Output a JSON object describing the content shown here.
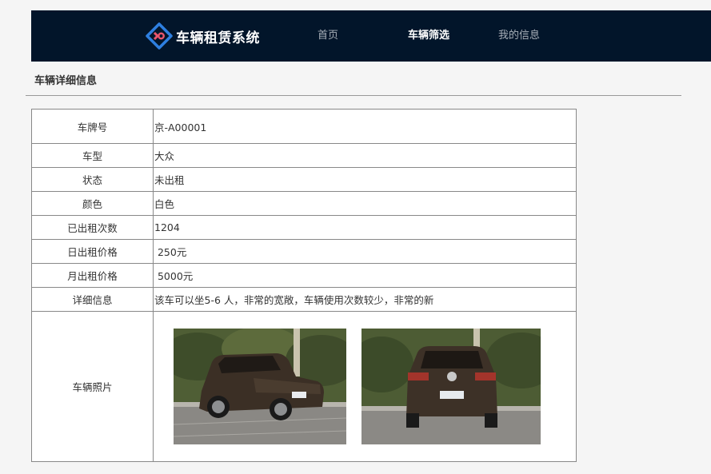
{
  "header": {
    "brand": "车辆租赁系统",
    "logo_icon": "diamond-logo-icon",
    "nav": [
      {
        "label": "首页",
        "active": false
      },
      {
        "label": "车辆筛选",
        "active": true
      },
      {
        "label": "我的信息",
        "active": false
      }
    ],
    "colors": {
      "background": "#02152a",
      "active": "#ffffff",
      "inactive": "#a8afb8"
    }
  },
  "section": {
    "title": "车辆详细信息"
  },
  "details": {
    "rows": [
      {
        "label": "车牌号",
        "value": "京-A00001"
      },
      {
        "label": "车型",
        "value": "大众"
      },
      {
        "label": "状态",
        "value": "未出租"
      },
      {
        "label": "颜色",
        "value": "白色"
      },
      {
        "label": "已出租次数",
        "value": "1204"
      },
      {
        "label": "日出租价格",
        "value": " 250元"
      },
      {
        "label": "月出租价格",
        "value": " 5000元"
      },
      {
        "label": "详细信息",
        "value": "该车可以坐5-6 人，非常的宽敞，车辆使用次数较少，非常的新"
      }
    ],
    "photos_label": "车辆照片",
    "photos": [
      "car-front-photo",
      "car-rear-photo"
    ]
  }
}
